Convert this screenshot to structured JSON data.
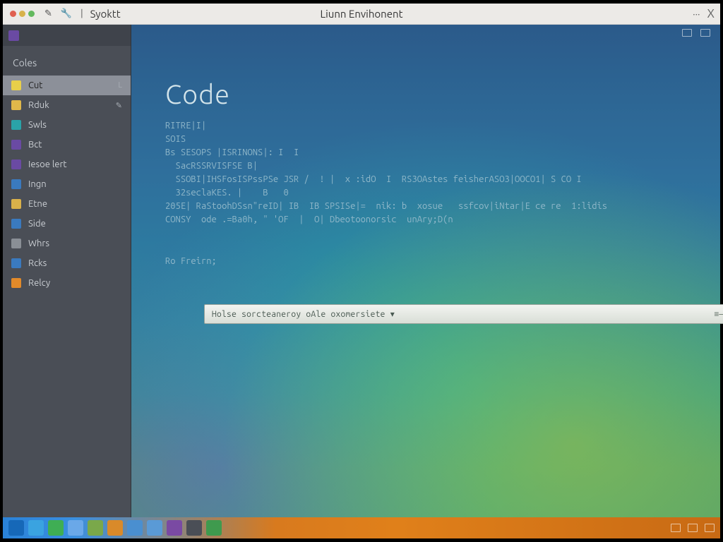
{
  "titlebar": {
    "app_label": "Syoktt",
    "center_title": "Liunn Envihonent",
    "menu_ellipsis": "···",
    "close_glyph": "X"
  },
  "sidebar": {
    "section": "Coles",
    "items": [
      {
        "label": "Cut",
        "tag": "L",
        "color": "#e8cf4a",
        "active": true
      },
      {
        "label": "Rduk",
        "tag": "✎",
        "color": "#e0b84a"
      },
      {
        "label": "Swls",
        "tag": "",
        "color": "#2aa3a8"
      },
      {
        "label": "Bct",
        "tag": "",
        "color": "#6a4aa3"
      },
      {
        "label": "Iesoe lert",
        "tag": "",
        "color": "#6a4aa3"
      },
      {
        "label": "Ingn",
        "tag": "",
        "color": "#3a7abf"
      },
      {
        "label": "Etne",
        "tag": "",
        "color": "#d9b14a"
      },
      {
        "label": "Side",
        "tag": "",
        "color": "#3a7abf"
      },
      {
        "label": "Whrs",
        "tag": "",
        "color": "#8a8f96"
      },
      {
        "label": "Rcks",
        "tag": "",
        "color": "#3a7abf"
      },
      {
        "label": "Relcy",
        "tag": "",
        "color": "#e28a2a"
      }
    ]
  },
  "editor": {
    "heading": "Code",
    "cmdbar_text": "Holse sorcteaneroy oAle oxomersiete ▾",
    "after_cmd": "Ro Freirn;",
    "lines": [
      "RITRE|I|",
      "",
      "SOIS",
      "Bs SESOPS |ISRINONS|: I  I",
      "  SacRSSRVISFSE B|",
      "  SSOBI|IHSFosISPssPSe JSR /  ! |  x :idO  I  RS3OAstes feisherASO3|OOCO1| S CO I",
      "  32seclaKES. |    B   0",
      "205E| RaStoohDSsn\"reID| IB  IB SPSISe|=  nik: b  xosue   ssfcov|iNtar|E ce re  1:lidis",
      "CONSY  ode .=Ba0h, \" 'OF  |  O| Dbeotoonorsic  unAry;D(n"
    ]
  },
  "taskbar": {
    "icons": [
      {
        "name": "start",
        "color": "#1668b8"
      },
      {
        "name": "browser",
        "color": "#3aa3e0"
      },
      {
        "name": "leaf",
        "color": "#3fae54"
      },
      {
        "name": "cloud",
        "color": "#6aa8e8"
      },
      {
        "name": "sheets",
        "color": "#7aa84a"
      },
      {
        "name": "files",
        "color": "#d98a2a"
      },
      {
        "name": "panel1",
        "color": "#4a8fd0"
      },
      {
        "name": "panel2",
        "color": "#5a9ad6"
      },
      {
        "name": "purple",
        "color": "#7a4aa3"
      },
      {
        "name": "term",
        "color": "#4a4e56"
      },
      {
        "name": "green",
        "color": "#3f9a4e"
      }
    ]
  }
}
